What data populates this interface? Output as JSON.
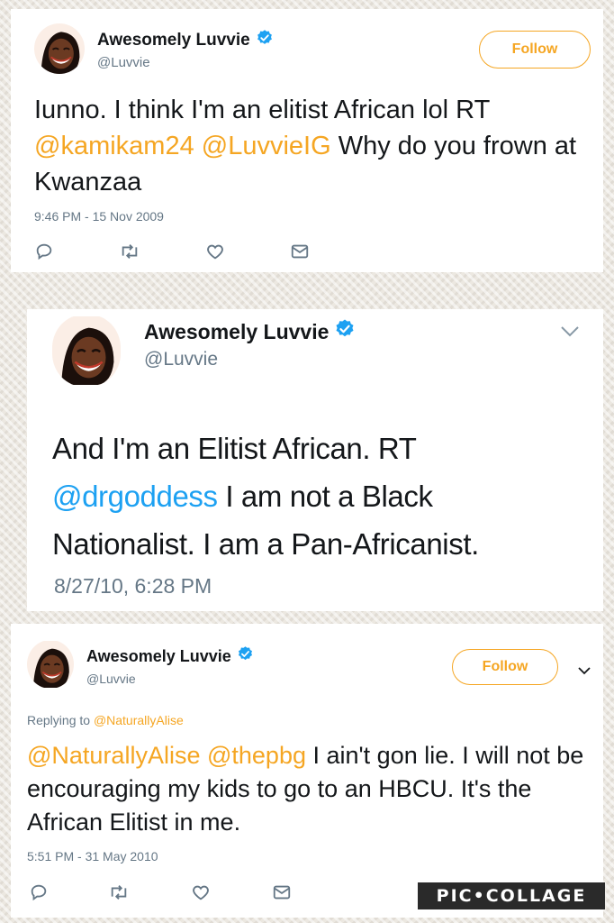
{
  "tweets": [
    {
      "name": "Awesomely Luvvie",
      "handle": "@Luvvie",
      "follow_label": "Follow",
      "text_before": "Iunno. I think I'm an elitist African lol RT ",
      "mention_1": "@kamikam24",
      "mention_2": "@LuvvieIG",
      "text_after": " Why do you frown at Kwanzaa",
      "timestamp": "9:46 PM - 15 Nov 2009"
    },
    {
      "name": "Awesomely Luvvie",
      "handle": "@Luvvie",
      "text_before": "And I'm an Elitist African. RT ",
      "mention_1": "@drgoddess",
      "text_after": " I am not a Black Nationalist. I am a Pan-Africanist.",
      "timestamp": "8/27/10, 6:28 PM"
    },
    {
      "name": "Awesomely Luvvie",
      "handle": "@Luvvie",
      "follow_label": "Follow",
      "replying_label": "Replying to ",
      "replying_handle": "@NaturallyAlise",
      "mention_1": "@NaturallyAlise",
      "mention_2": "@thepbg",
      "text_after": " I ain't gon lie. I will not be encouraging my kids to go to an HBCU. It's the African Elitist in me.",
      "timestamp": "5:51 PM - 31 May 2010"
    }
  ],
  "watermark": "PIC•COLLAGE",
  "colors": {
    "accent": "#f5a623",
    "verified": "#1da1f2",
    "muted": "#657786",
    "text": "#14171a"
  },
  "icons": [
    "reply-icon",
    "retweet-icon",
    "like-icon",
    "direct-message-icon",
    "verified-badge-icon",
    "chevron-down-icon"
  ]
}
